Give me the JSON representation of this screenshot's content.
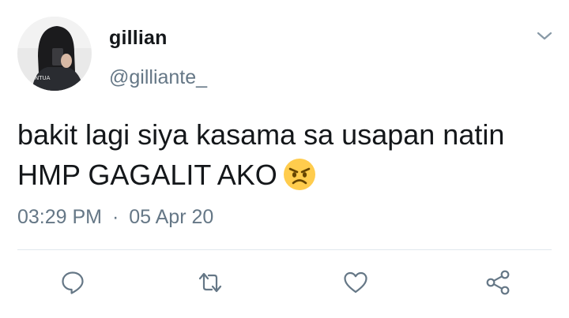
{
  "user": {
    "display_name": "gillian",
    "handle": "@gilliante_",
    "avatar_shirt_text": "NTUA"
  },
  "tweet": {
    "text": "bakit lagi siya kasama sa usapan natin HMP GAGALIT AKO",
    "emoji": "angry-face-icon",
    "time": "03:29 PM",
    "separator": "·",
    "date": "05 Apr 20"
  },
  "actions": [
    "reply-icon",
    "retweet-icon",
    "like-icon",
    "share-icon"
  ],
  "colors": {
    "text": "#14171a",
    "secondary": "#657786",
    "icon": "#657786",
    "divider": "#e1e8ed",
    "emoji": "#ffcc4d"
  }
}
